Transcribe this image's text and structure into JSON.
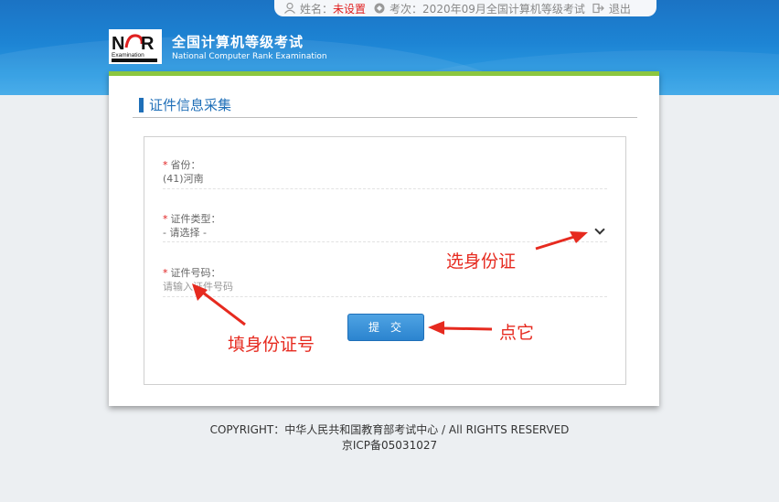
{
  "userbar": {
    "name_label": "姓名：",
    "name_value": "未设置",
    "exam_label": "考次：",
    "exam_value": "2020年09月全国计算机等级考试",
    "logout": "退出"
  },
  "brand": {
    "logo_text": "NCRE",
    "logo_small": "Examination",
    "title": "全国计算机等级考试",
    "subtitle": "National Computer Rank Examination"
  },
  "section": {
    "title": "证件信息采集"
  },
  "form": {
    "province": {
      "label": "省份：",
      "value": "(41)河南"
    },
    "id_type": {
      "label": "证件类型：",
      "selected": "- 请选择 -"
    },
    "id_number": {
      "label": "证件号码：",
      "placeholder": "请输入证件号码"
    },
    "required_mark": "*",
    "submit": "提交"
  },
  "annotations": {
    "choose_id": "选身份证",
    "fill_id": "填身份证号",
    "click_it": "点它"
  },
  "footer": {
    "copyright": "COPYRIGHT：中华人民共和国教育部考试中心 / All RIGHTS RESERVED",
    "icp": "京ICP备05031027"
  },
  "colors": {
    "header_blue": "#1d84d4",
    "accent_green": "#8cc63f",
    "title_blue": "#1f6fb8",
    "annotation_red": "#e62a1f",
    "required_red": "#e02020"
  }
}
